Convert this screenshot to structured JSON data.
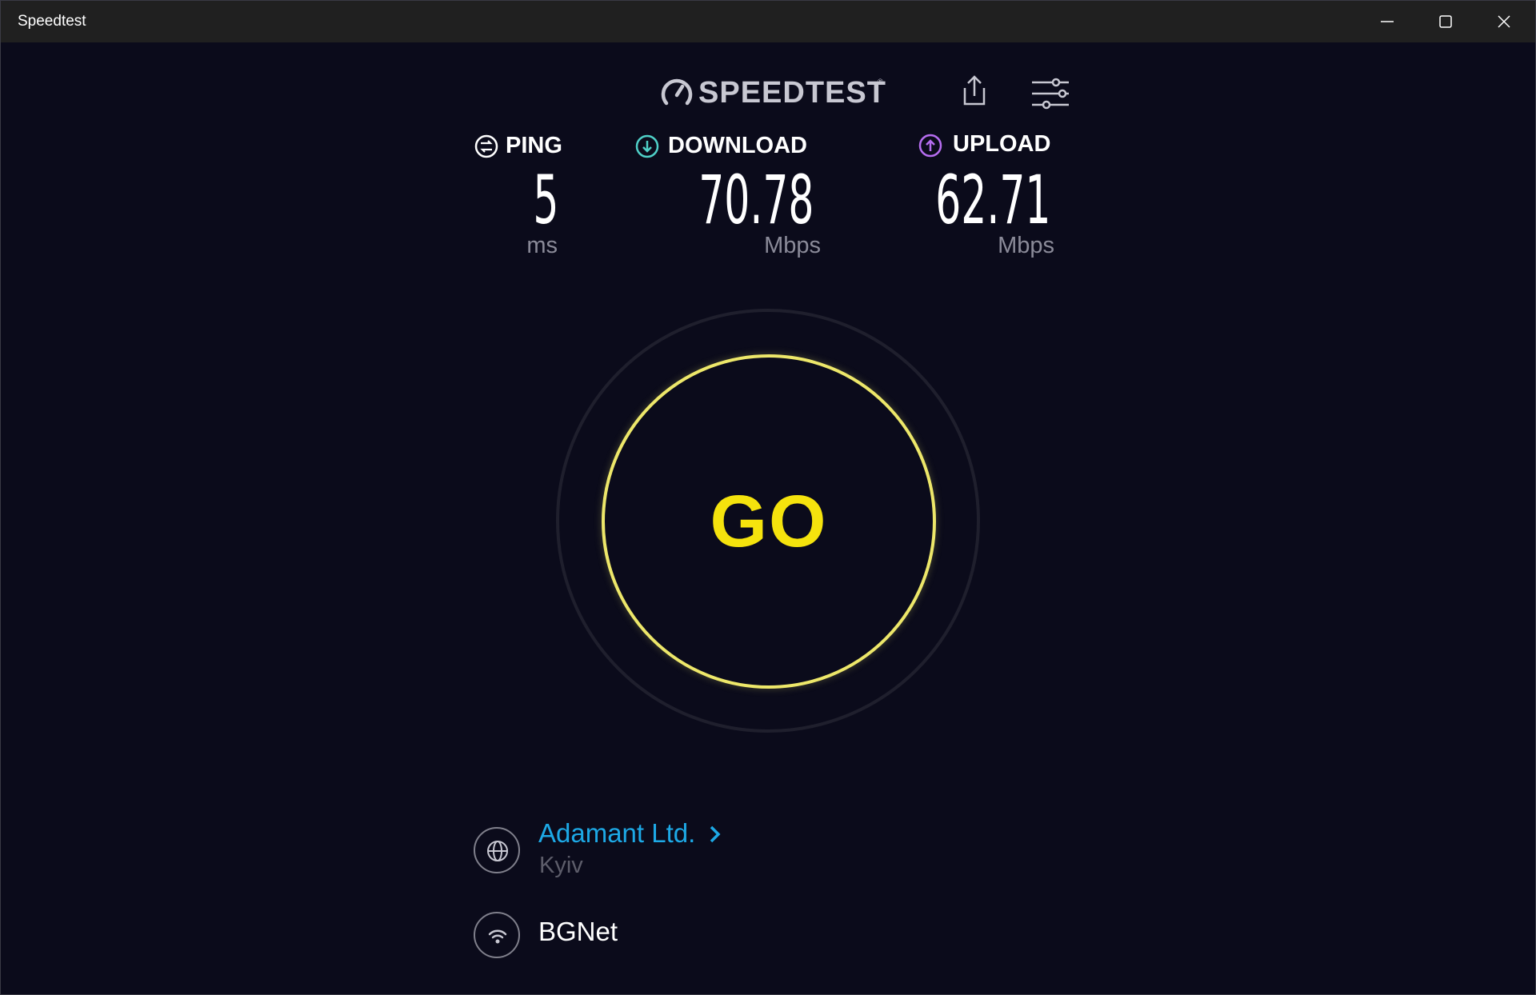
{
  "window": {
    "title": "Speedtest"
  },
  "header": {
    "brand": "SPEEDTEST",
    "trademark": "®",
    "icons": [
      "share-icon",
      "settings-sliders-icon"
    ]
  },
  "metrics": {
    "ping": {
      "label": "PING",
      "value": "5",
      "unit": "ms",
      "icon": "ping-icon",
      "color": "#ffffff"
    },
    "download": {
      "label": "DOWNLOAD",
      "value": "70.78",
      "unit": "Mbps",
      "icon": "download-arrow-icon",
      "color": "#4fd0c8"
    },
    "upload": {
      "label": "UPLOAD",
      "value": "62.71",
      "unit": "Mbps",
      "icon": "upload-arrow-icon",
      "color": "#b66df0"
    }
  },
  "go_button": {
    "label": "GO",
    "ring_color": "#ede76a",
    "text_color": "#f5e30d"
  },
  "server": {
    "name": "Adamant Ltd.",
    "location": "Kyiv",
    "icon": "globe-icon",
    "link_color": "#1da9e6"
  },
  "network": {
    "name": "BGNet",
    "icon": "wifi-icon"
  }
}
